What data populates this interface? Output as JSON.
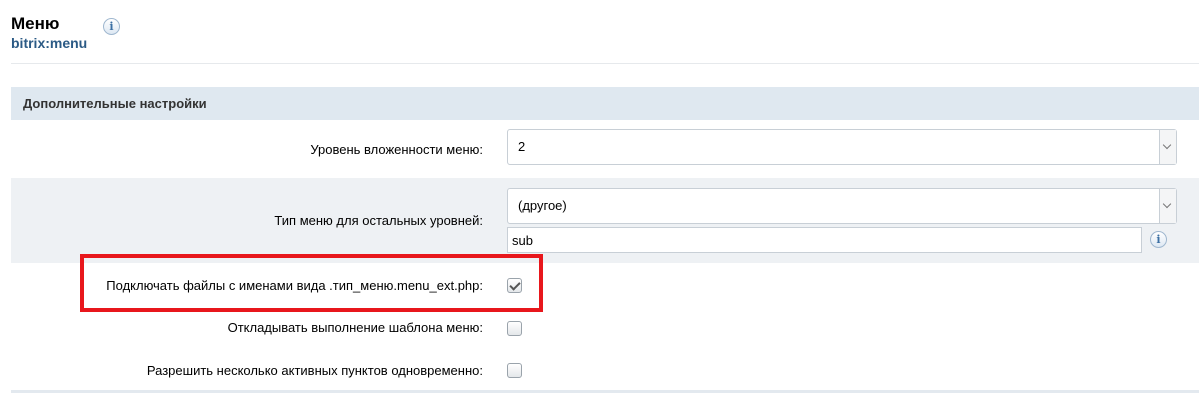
{
  "header": {
    "title": "Меню",
    "component": "bitrix:menu",
    "info_icon": "i"
  },
  "section": {
    "title": "Дополнительные настройки"
  },
  "settings": {
    "max_level": {
      "label": "Уровень вложенности меню:",
      "value": "2"
    },
    "child_menu_type": {
      "label": "Тип меню для остальных уровней:",
      "select_value": "(другое)",
      "input_value": "sub",
      "info_icon": "i"
    },
    "use_ext": {
      "label": "Подключать файлы с именами вида .тип_меню.menu_ext.php:",
      "checked": true
    },
    "delay": {
      "label": "Откладывать выполнение шаблона меню:",
      "checked": false
    },
    "allow_multi_select": {
      "label": "Разрешить несколько активных пунктов одновременно:",
      "checked": false
    }
  },
  "colors": {
    "highlight_border": "#e8171c",
    "section_background": "#dfe8f0",
    "component_link": "#2b5a85"
  }
}
